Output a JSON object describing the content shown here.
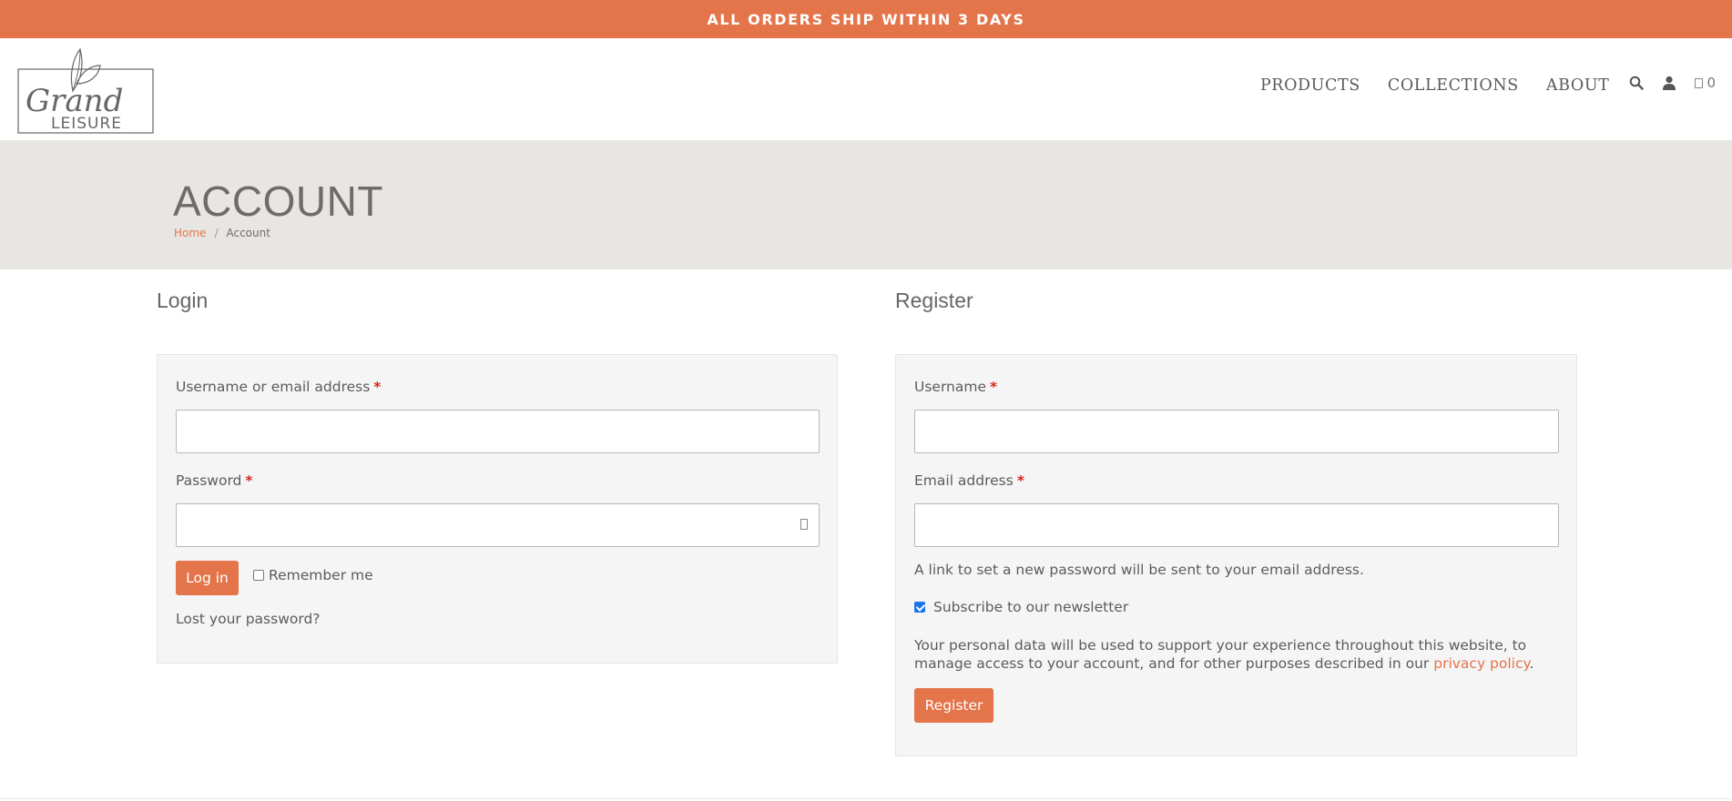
{
  "announcement": {
    "text": "ALL ORDERS SHIP WITHIN 3 DAYS"
  },
  "brand": {
    "logo_text_1": "Grand",
    "logo_text_2": "LEISURE",
    "accent_color": "#e4744a"
  },
  "nav": {
    "items": [
      {
        "label": "PRODUCTS"
      },
      {
        "label": "COLLECTIONS"
      },
      {
        "label": "ABOUT"
      }
    ],
    "icons": [
      "search-icon",
      "user-icon",
      "cart-icon"
    ],
    "cart_count": "0"
  },
  "page": {
    "title": "ACCOUNT",
    "breadcrumb": {
      "home": "Home",
      "separator": "/",
      "current": "Account"
    }
  },
  "login": {
    "heading": "Login",
    "username_label": "Username or email address",
    "required_mark": "*",
    "username_value": "",
    "password_label": "Password",
    "password_value": "",
    "submit_label": "Log in",
    "remember_label": "Remember me",
    "remember_checked": false,
    "lost_password": "Lost your password?"
  },
  "register": {
    "heading": "Register",
    "username_label": "Username",
    "required_mark": "*",
    "username_value": "",
    "email_label": "Email address",
    "email_value": "",
    "password_note": "A link to set a new password will be sent to your email address.",
    "newsletter_label": "Subscribe to our newsletter",
    "newsletter_checked": true,
    "privacy_text": "Your personal data will be used to support your experience throughout this website, to manage access to your account, and for other purposes described in our",
    "privacy_link": "privacy policy",
    "privacy_end": ".",
    "submit_label": "Register"
  }
}
